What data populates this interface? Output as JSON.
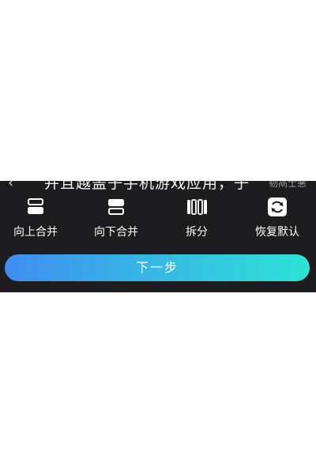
{
  "caption": {
    "text": "并且越盖子手机游戏应用，子",
    "corner_text": "韧鬲士悪",
    "back_icon": "chevron-left-icon"
  },
  "toolbar": {
    "items": [
      {
        "label": "向上合并",
        "icon": "merge-up-icon"
      },
      {
        "label": "向下合并",
        "icon": "merge-down-icon"
      },
      {
        "label": "拆分",
        "icon": "split-icon"
      },
      {
        "label": "恢复默认",
        "icon": "restore-default-icon"
      }
    ]
  },
  "next_button": {
    "label": "下一步"
  },
  "colors": {
    "panel_background": "#1d1d1f",
    "gradient_start": "#3f8df1",
    "gradient_end": "#2ee3d6",
    "text": "#ffffff"
  }
}
